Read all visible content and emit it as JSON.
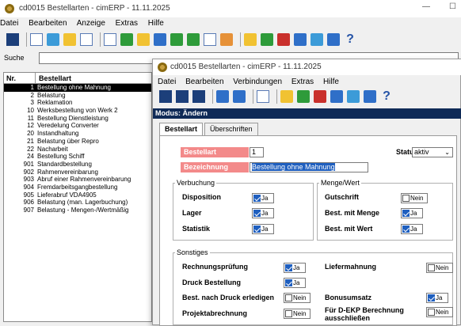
{
  "main_window": {
    "title": "cd0015 Bestellarten - cimERP - 11.11.2025",
    "menu": [
      "Datei",
      "Bearbeiten",
      "Anzeige",
      "Extras",
      "Hilfe"
    ],
    "minimize_glyph": "—",
    "maximize_glyph": "☐"
  },
  "search": {
    "label": "Suche",
    "value": ""
  },
  "list": {
    "columns": [
      "Nr.",
      "Bestellart"
    ],
    "rows": [
      {
        "nr": "1",
        "name": "Bestellung ohne Mahnung",
        "selected": true
      },
      {
        "nr": "2",
        "name": "Belastung"
      },
      {
        "nr": "3",
        "name": "Reklamation"
      },
      {
        "nr": "10",
        "name": "Werksbestellung von Werk 2"
      },
      {
        "nr": "11",
        "name": "Bestellung Dienstleistung"
      },
      {
        "nr": "12",
        "name": "Veredelung Converter"
      },
      {
        "nr": "20",
        "name": "Instandhaltung"
      },
      {
        "nr": "21",
        "name": "Belastung über Repro"
      },
      {
        "nr": "22",
        "name": "Nacharbeit"
      },
      {
        "nr": "24",
        "name": "Bestellung Schiff"
      },
      {
        "nr": "901",
        "name": "Standardbestellung"
      },
      {
        "nr": "902",
        "name": "Rahmenvereinbarung"
      },
      {
        "nr": "903",
        "name": "Abruf einer Rahmenvereinbarung"
      },
      {
        "nr": "904",
        "name": "Fremdarbeitsgangbestellung"
      },
      {
        "nr": "905",
        "name": "Lieferabruf VDA4905"
      },
      {
        "nr": "906",
        "name": "Belastung (man. Lagerbuchung)"
      },
      {
        "nr": "907",
        "name": "Belastung - Mengen-/Wertmäßig"
      }
    ]
  },
  "dialog": {
    "title": "cd0015 Bestellarten - cimERP - 11.11.2025",
    "menu": [
      "Datei",
      "Bearbeiten",
      "Verbindungen",
      "Extras",
      "Hilfe"
    ],
    "modus": "Modus: Ändern",
    "tabs": [
      "Bestellart",
      "Überschriften"
    ],
    "bestellart_label": "Bestellart",
    "bestellart_value": "1",
    "bezeichnung_label": "Bezeichnung",
    "bezeichnung_value": "Bestellung ohne Mahnung",
    "status_label": "Status",
    "status_value": "aktiv",
    "verbuchung": {
      "legend": "Verbuchung",
      "disposition": "Disposition",
      "lager": "Lager",
      "statistik": "Statistik"
    },
    "mengewert": {
      "legend": "Menge/Wert",
      "gutschrift": "Gutschrift",
      "best_menge": "Best. mit Menge",
      "best_wert": "Best. mit Wert"
    },
    "sonstiges": {
      "legend": "Sonstiges",
      "rechnung": "Rechnungsprüfung",
      "liefermahnung": "Liefermahnung",
      "druck": "Druck Bestellung",
      "best_druck": "Best. nach Druck erledigen",
      "bonus": "Bonusumsatz",
      "projekt": "Projektabrechnung",
      "dekp": "Für D-EKP Berechnung ausschließen"
    },
    "ja": "Ja",
    "nein": "Nein"
  },
  "colors": {
    "modus_bg": "#0f2a57",
    "label_red": "#f38a8a",
    "check_blue": "#1f5fbf"
  }
}
